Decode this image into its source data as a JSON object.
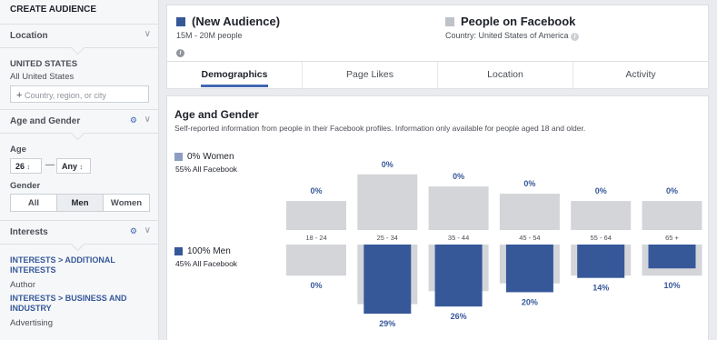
{
  "sidebar": {
    "header": "CREATE AUDIENCE",
    "location": {
      "title": "Location",
      "country_label": "UNITED STATES",
      "country_value": "All United States",
      "input_placeholder": "Country, region, or city"
    },
    "age_gender": {
      "title": "Age and Gender",
      "age_label": "Age",
      "age_min": "26",
      "age_max": "Any",
      "gender_label": "Gender",
      "gender_options": [
        "All",
        "Men",
        "Women"
      ],
      "gender_selected": "Men"
    },
    "interests": {
      "title": "Interests",
      "items": [
        {
          "path": "INTERESTS > ADDITIONAL INTERESTS",
          "value": "Author"
        },
        {
          "path": "INTERESTS > BUSINESS AND INDUSTRY",
          "value": "Advertising"
        }
      ]
    }
  },
  "audiences": {
    "new": {
      "title": "(New Audience)",
      "size": "15M - 20M people",
      "color": "#365899"
    },
    "facebook": {
      "title": "People on Facebook",
      "country": "Country: United States of America",
      "color": "#bec2c9"
    }
  },
  "tabs": [
    {
      "label": "Demographics",
      "active": true
    },
    {
      "label": "Page Likes",
      "active": false
    },
    {
      "label": "Location",
      "active": false
    },
    {
      "label": "Activity",
      "active": false
    }
  ],
  "section": {
    "title": "Age and Gender",
    "description": "Self-reported information from people in their Facebook profiles. Information only available for people aged 18 and older."
  },
  "legend": {
    "women": {
      "title": "0% Women",
      "sub_pct": "55%",
      "sub_label": "All Facebook"
    },
    "men": {
      "title": "100% Men",
      "sub_pct": "45%",
      "sub_label": "All Facebook"
    }
  },
  "chart_data": {
    "type": "bar",
    "categories": [
      "18 - 24",
      "25 - 34",
      "35 - 44",
      "45 - 54",
      "55 - 64",
      "65 +"
    ],
    "series": [
      {
        "name": "Women",
        "values": [
          0,
          0,
          0,
          0,
          0,
          0
        ],
        "labels": [
          "0%",
          "0%",
          "0%",
          "0%",
          "0%",
          "0%"
        ],
        "baseline_values": [
          12,
          23,
          18,
          15,
          12,
          12
        ]
      },
      {
        "name": "Men",
        "values": [
          0,
          29,
          26,
          20,
          14,
          10
        ],
        "labels": [
          "0%",
          "29%",
          "26%",
          "20%",
          "14%",
          "10%"
        ],
        "baseline_values": [
          12,
          23,
          18,
          15,
          12,
          12
        ]
      }
    ],
    "colors": {
      "selected": "#365899",
      "baseline": "#d3d5d9"
    }
  }
}
